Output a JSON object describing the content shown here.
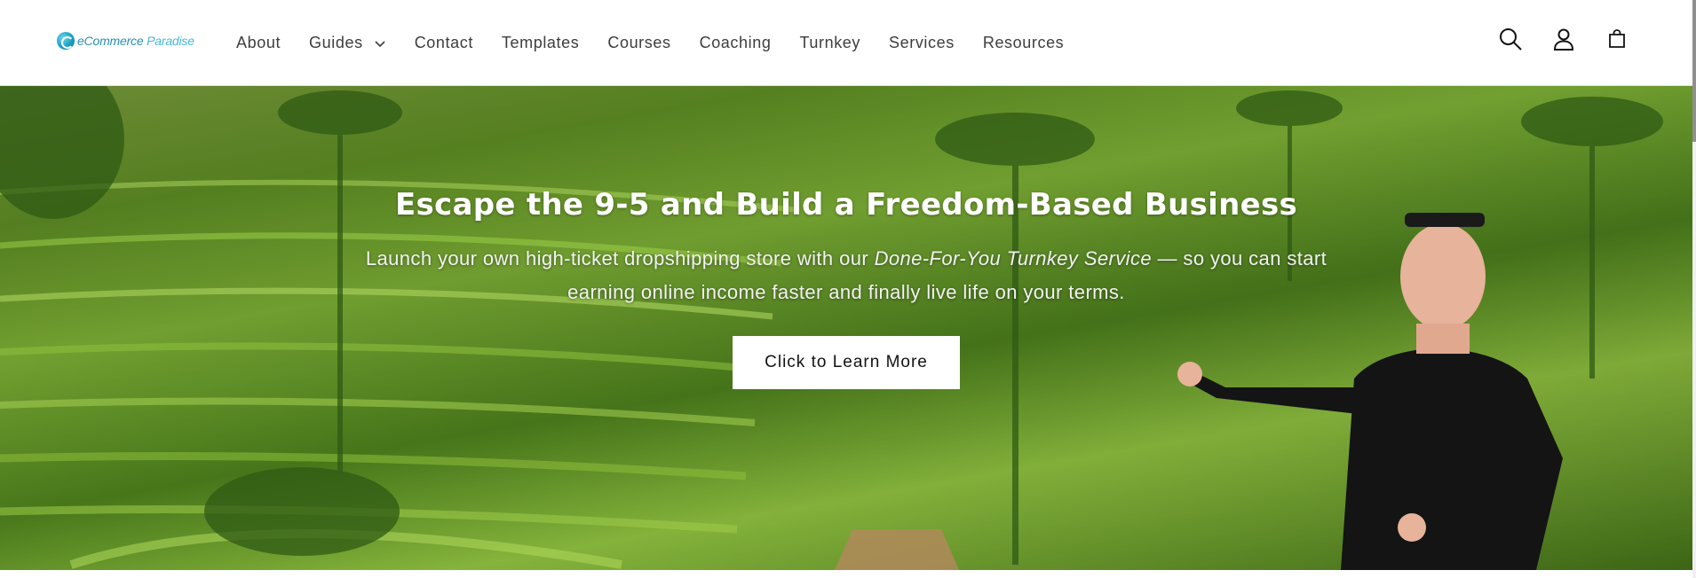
{
  "brand": {
    "part1": "eCommerce",
    "part2": " Paradise",
    "logo_icon": "globe-logo-icon"
  },
  "nav": {
    "items": [
      {
        "label": "About"
      },
      {
        "label": "Guides",
        "has_dropdown": true
      },
      {
        "label": "Contact"
      },
      {
        "label": "Templates"
      },
      {
        "label": "Courses"
      },
      {
        "label": "Coaching"
      },
      {
        "label": "Turnkey"
      },
      {
        "label": "Services"
      },
      {
        "label": "Resources"
      }
    ]
  },
  "header_icons": [
    "search-icon",
    "account-icon",
    "cart-icon"
  ],
  "hero": {
    "title": "Escape the 9-5 and Build a Freedom-Based Business",
    "subtitle_pre": "Launch your own high-ticket dropshipping store with our ",
    "subtitle_em": "Done-For-You Turnkey Service",
    "subtitle_post": " — so you can start earning online income faster and finally live life on your terms.",
    "cta_label": "Click to Learn More"
  },
  "colors": {
    "brand": "#2a8fb3",
    "nav_text": "#3d3d3d",
    "cta_bg": "#ffffff",
    "hero_green": "#6fa52c"
  }
}
